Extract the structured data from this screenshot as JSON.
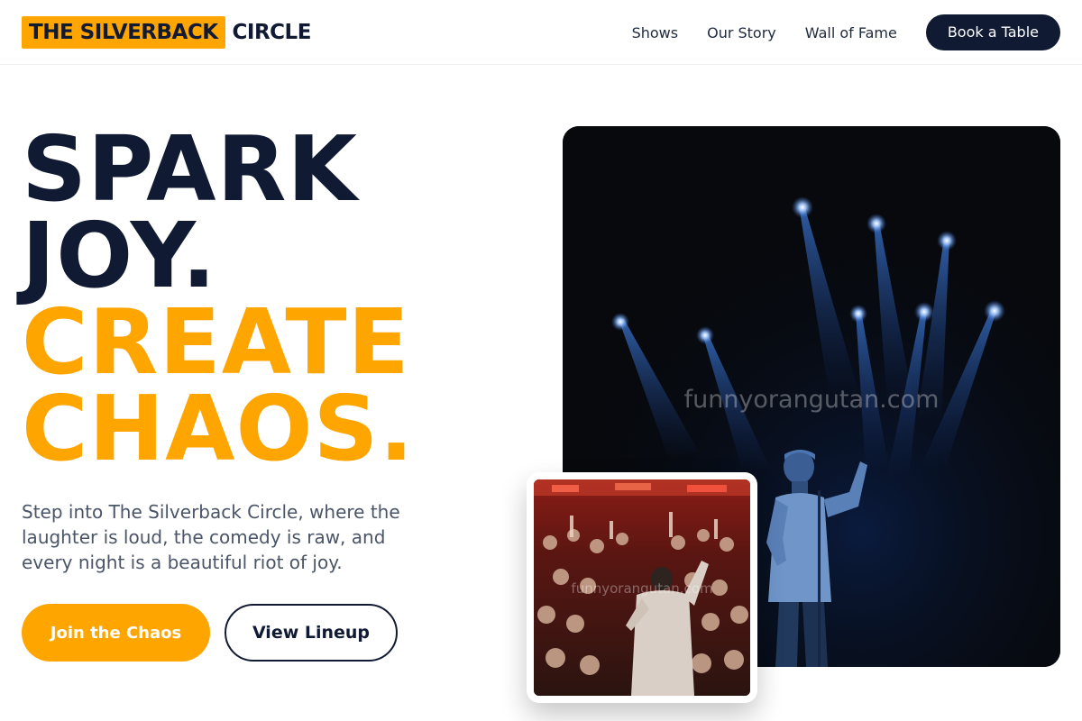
{
  "header": {
    "logo_mark": "THE SILVERBACK",
    "logo_word": "CIRCLE",
    "nav": [
      "Shows",
      "Our Story",
      "Wall of Fame"
    ],
    "cta_label": "Book a Table"
  },
  "hero": {
    "headline": [
      "SPARK",
      "JOY.",
      "CREATE",
      "CHAOS."
    ],
    "lede": "Step into The Silverback Circle, where the laughter is loud, the comedy is raw, and every night is a beautiful riot of joy.",
    "primary_label": "Join the Chaos",
    "secondary_label": "View Lineup"
  },
  "images": {
    "stage_watermark": "funnyorangutan.com",
    "crowd_watermark": "funnyorangutan.com"
  },
  "colors": {
    "brand_accent": "#fea500",
    "brand_dark": "#111a33",
    "body_text": "#4a5568"
  }
}
